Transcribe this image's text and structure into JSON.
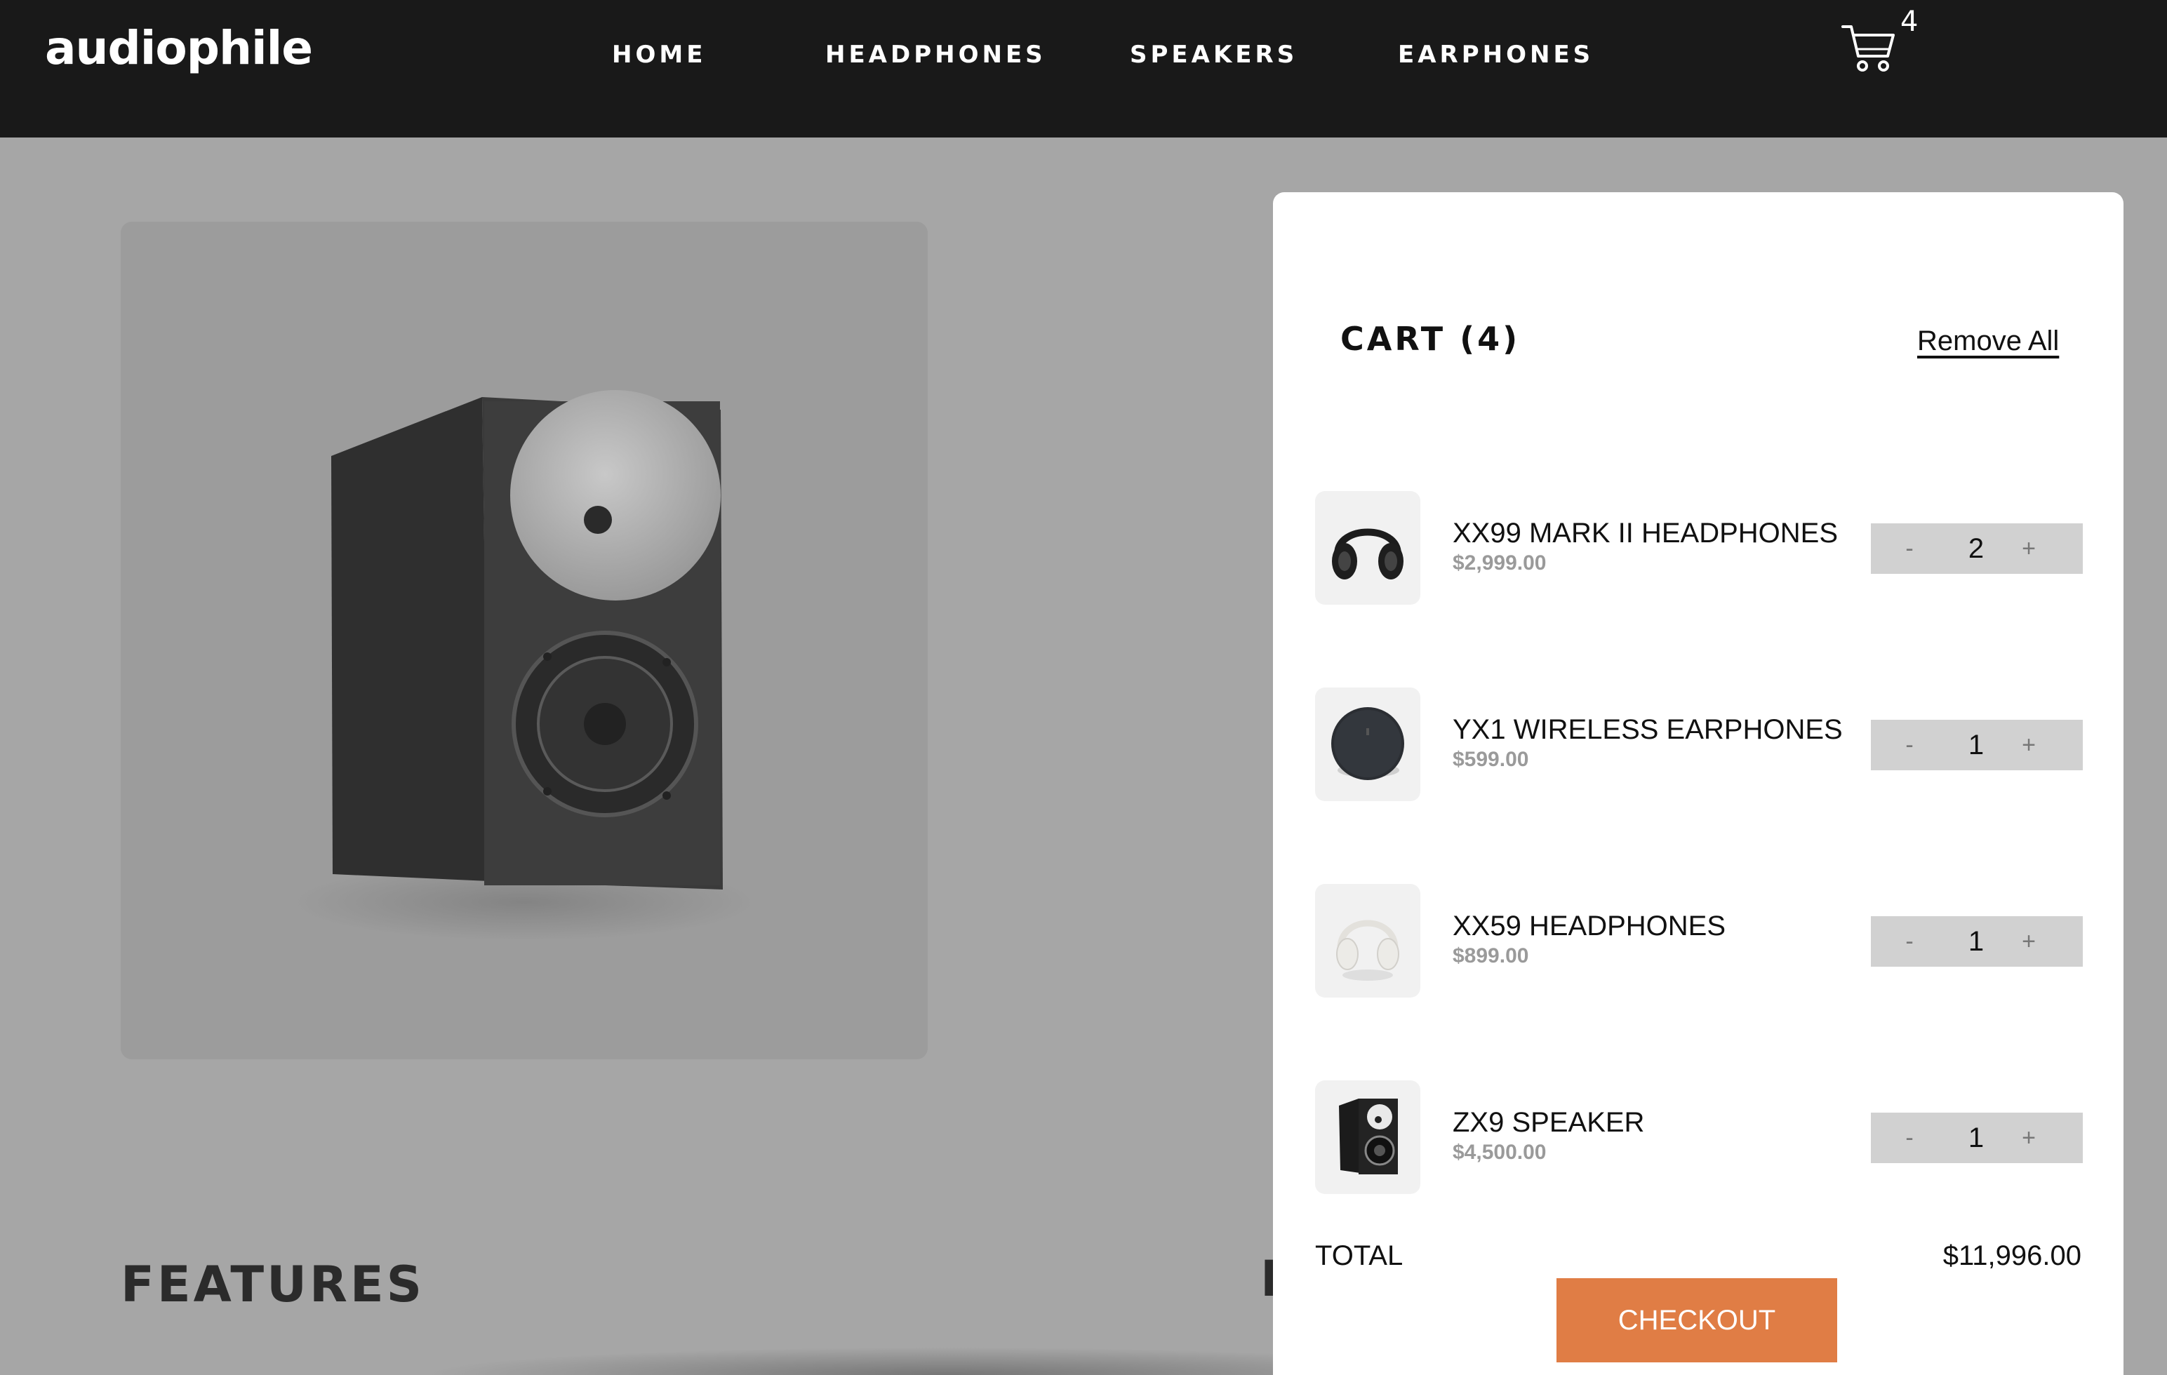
{
  "nav": {
    "logo": "audiophile",
    "links": [
      "HOME",
      "HEADPHONES",
      "SPEAKERS",
      "EARPHONES"
    ],
    "cart_count": "4"
  },
  "page": {
    "features_heading": "FEATURES",
    "partial_heading": "I"
  },
  "cart": {
    "title": "CART (4)",
    "remove_all": "Remove All",
    "minus_label": "-",
    "plus_label": "+",
    "items": [
      {
        "name": "XX99 MARK II HEADPHONES",
        "price": "$2,999.00",
        "qty": "2",
        "icon": "headphones-black"
      },
      {
        "name": "YX1 WIRELESS EARPHONES",
        "price": "$599.00",
        "qty": "1",
        "icon": "earphones-case"
      },
      {
        "name": "XX59 HEADPHONES",
        "price": "$899.00",
        "qty": "1",
        "icon": "headphones-white"
      },
      {
        "name": "ZX9 SPEAKER",
        "price": "$4,500.00",
        "qty": "1",
        "icon": "speaker"
      }
    ],
    "total_label": "TOTAL",
    "total_value": "$11,996.00",
    "checkout_label": "CHECKOUT"
  },
  "colors": {
    "nav_bg": "#191919",
    "overlay_bg": "#a6a6a6",
    "accent": "#e07d45",
    "stepper_bg": "#d1d1d1",
    "price_gray": "#9a9a9a"
  }
}
